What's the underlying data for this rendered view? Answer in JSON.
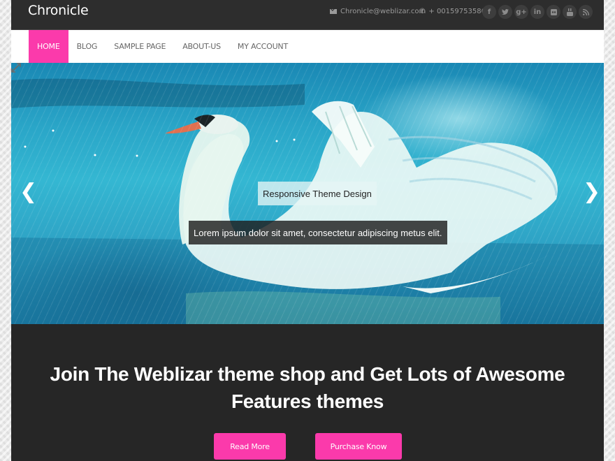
{
  "header": {
    "site_title": "Chronicle",
    "email": "Chronicle@weblizar.com",
    "phone": "+ 00159753586",
    "socials": [
      {
        "name": "facebook",
        "glyph": "f"
      },
      {
        "name": "twitter",
        "glyph": "t"
      },
      {
        "name": "google-plus",
        "glyph": "g+"
      },
      {
        "name": "linkedin",
        "glyph": "in"
      },
      {
        "name": "flickr",
        "glyph": "▪"
      },
      {
        "name": "youtube",
        "glyph": "▶"
      },
      {
        "name": "rss",
        "glyph": "≋"
      }
    ]
  },
  "nav": {
    "items": [
      {
        "label": "HOME",
        "active": true
      },
      {
        "label": "BLOG",
        "active": false
      },
      {
        "label": "SAMPLE PAGE",
        "active": false
      },
      {
        "label": "ABOUT-US",
        "active": false
      },
      {
        "label": "MY ACCOUNT",
        "active": false
      }
    ]
  },
  "slider": {
    "caption_title": "Responsive Theme Design",
    "caption_text": "Lorem ipsum dolor sit amet, consectetur adipiscing metus elit.",
    "prev_glyph": "❮",
    "next_glyph": "❯",
    "image_description": "white swan spreading wings on turquoise water in rain"
  },
  "cta": {
    "heading_line1": "Join The Weblizar theme shop and Get Lots of Awesome",
    "heading_line2": "Features themes",
    "read_more_label": "Read More",
    "purchase_label": "Purchase Know"
  },
  "colors": {
    "accent": "#fb3aab",
    "topbar": "#2d2d2d",
    "cta_background": "#262626"
  }
}
